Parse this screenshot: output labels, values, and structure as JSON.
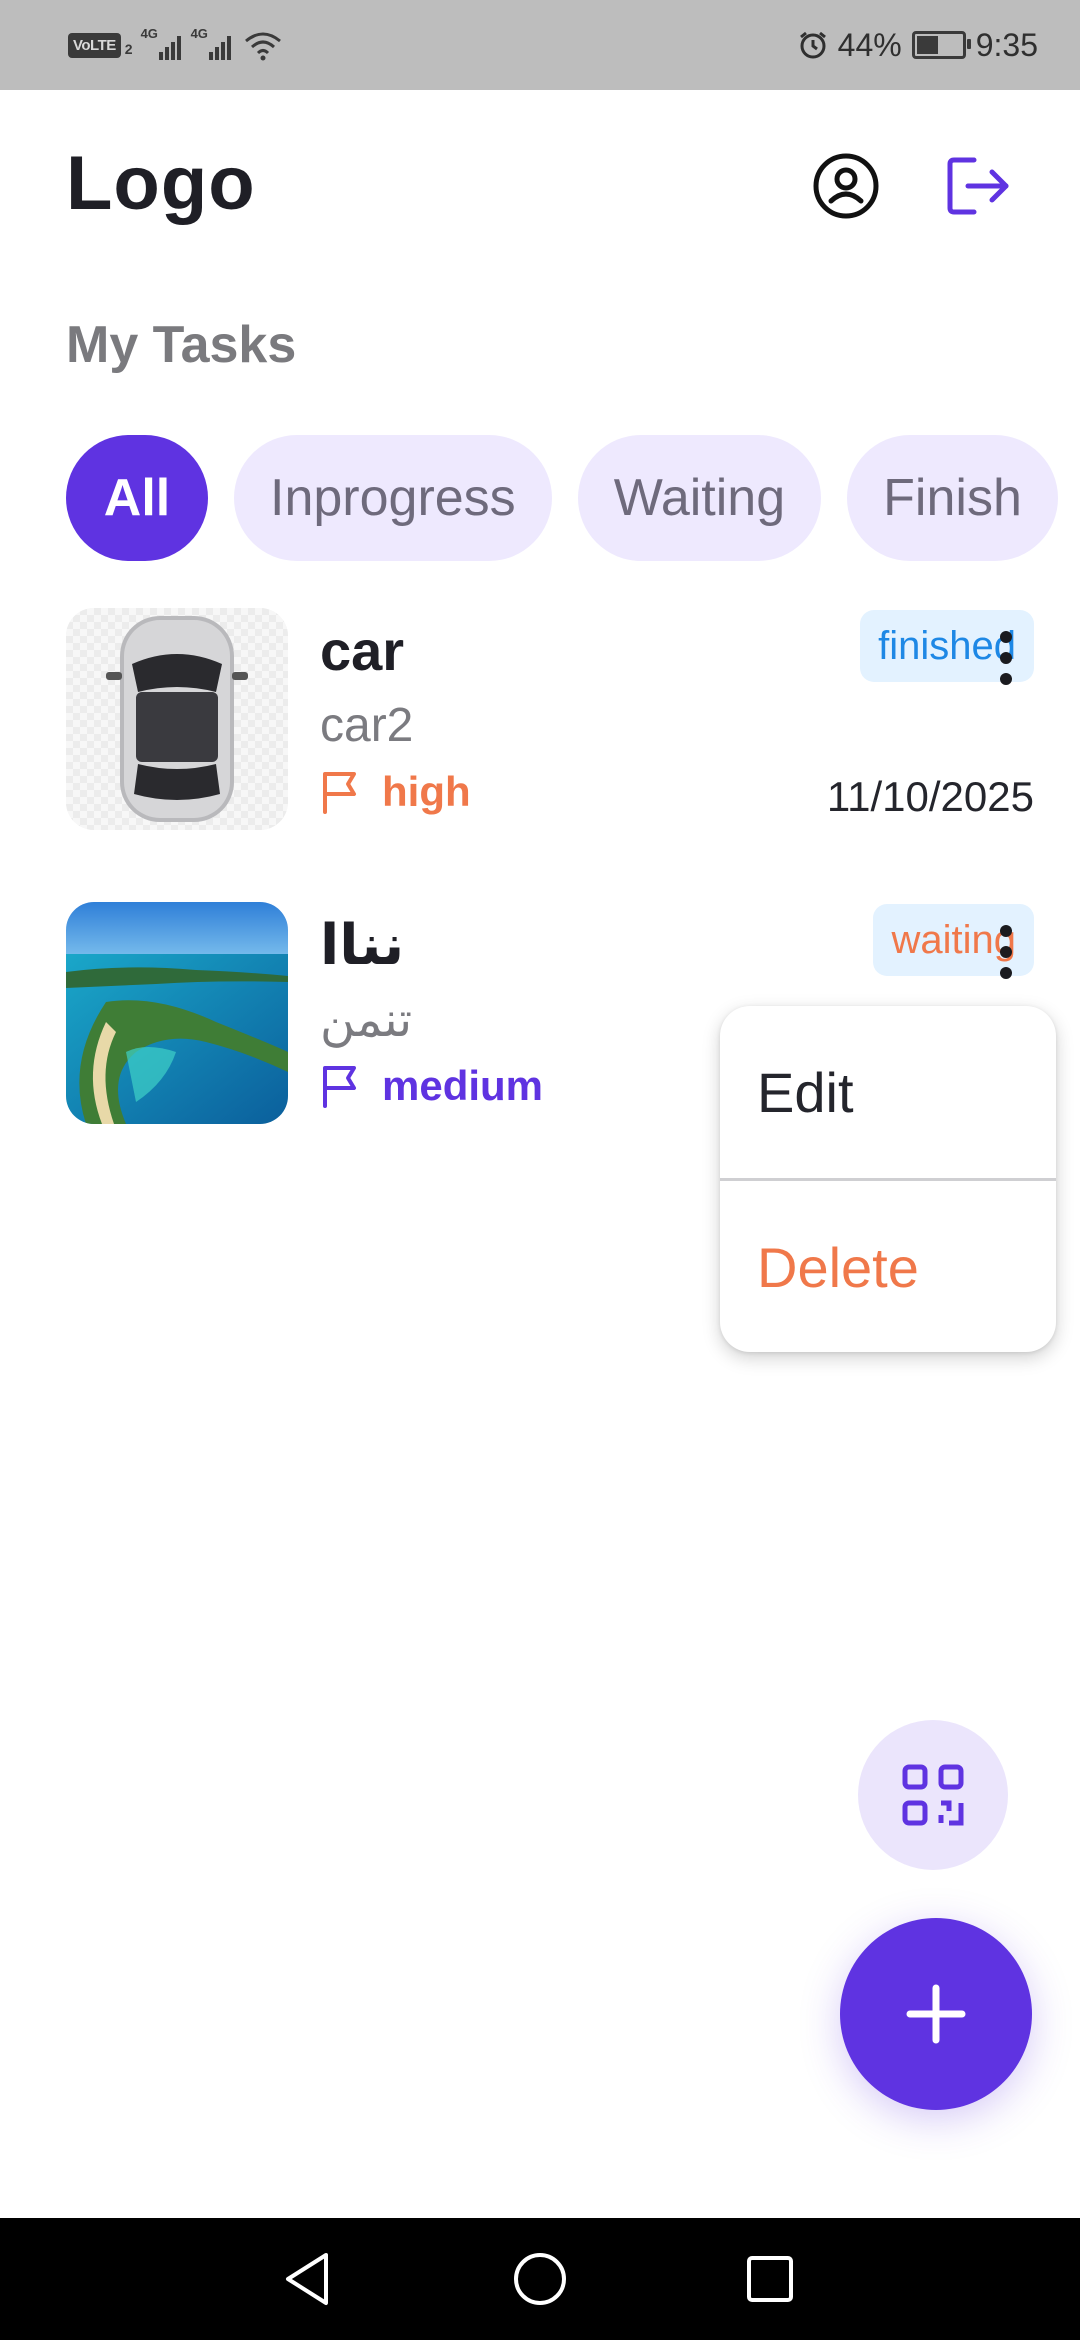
{
  "status_bar": {
    "volte": "VoLTE",
    "sim": "2",
    "network1": "4G",
    "network2": "4G",
    "battery": "44%",
    "battery_level": 0.44,
    "time": "9:35",
    "icons": [
      "volte-icon",
      "signal-icon",
      "signal-icon",
      "wifi-icon",
      "alarm-icon",
      "battery-icon"
    ]
  },
  "header": {
    "logo": "Logo",
    "profile_icon": "profile-icon",
    "logout_icon": "logout-icon"
  },
  "section_title": "My Tasks",
  "filters": [
    {
      "label": "All",
      "active": true
    },
    {
      "label": "Inprogress",
      "active": false
    },
    {
      "label": "Waiting",
      "active": false
    },
    {
      "label": "Finish",
      "active": false
    }
  ],
  "tasks": [
    {
      "title": "car",
      "description": "car2",
      "priority": "high",
      "priority_color": "#f0784a",
      "status": "finished",
      "status_color": "#1e88e5",
      "date": "11/10/2025",
      "image": "car-top-view"
    },
    {
      "title": "نناا",
      "description": "تنمن",
      "priority": "medium",
      "priority_color": "#5f33e1",
      "status": "waiting",
      "status_color": "#f0784a",
      "date": "",
      "image": "island-aerial-view"
    }
  ],
  "context_menu": {
    "edit": "Edit",
    "delete": "Delete",
    "delete_color": "#f0784a"
  },
  "fabs": {
    "qr_icon": "qr-code-icon",
    "add_icon": "plus-icon"
  },
  "colors": {
    "accent": "#5f33e1",
    "chip_bg": "#eee9fe",
    "status_bg": "#e3f2ff"
  },
  "nav_bar": [
    "back-icon",
    "home-icon",
    "recents-icon"
  ]
}
